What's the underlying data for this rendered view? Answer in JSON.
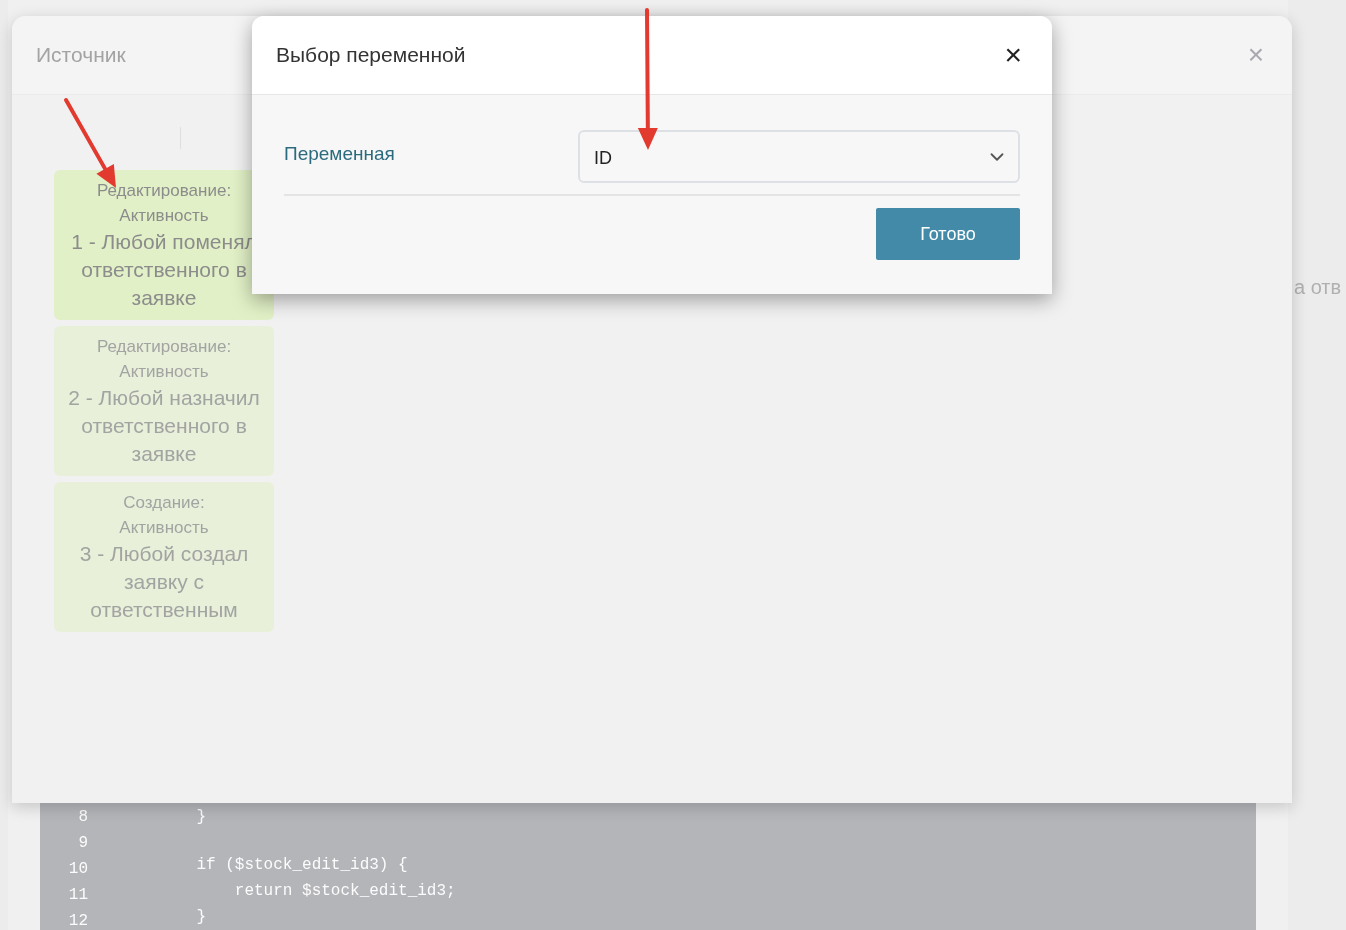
{
  "background_page": {
    "partial_text": "а отв",
    "code": [
      {
        "number": "8",
        "text": "    }"
      },
      {
        "number": "9"
      },
      {
        "number": "10",
        "text": "    if ($stock_edit_id3) {"
      },
      {
        "number": "11",
        "text": "        return $stock_edit_id3;"
      },
      {
        "number": "12",
        "text": "    }"
      }
    ]
  },
  "source_modal": {
    "title": "Источник",
    "close": "×",
    "events": [
      {
        "type": "Редактирование:",
        "category": "Активность",
        "name": "1 - Любой поменял ответственного в заявке",
        "selected": true
      },
      {
        "type": "Редактирование:",
        "category": "Активность",
        "name": "2 - Любой назначил ответственного в заявке",
        "selected": false
      },
      {
        "type": "Создание:",
        "category": "Активность",
        "name": "3 - Любой создал заявку с ответственным",
        "selected": false
      }
    ]
  },
  "variable_dialog": {
    "title": "Выбор переменной",
    "close": "×",
    "field_label": "Переменная",
    "value": "ID",
    "button": "Готово"
  }
}
